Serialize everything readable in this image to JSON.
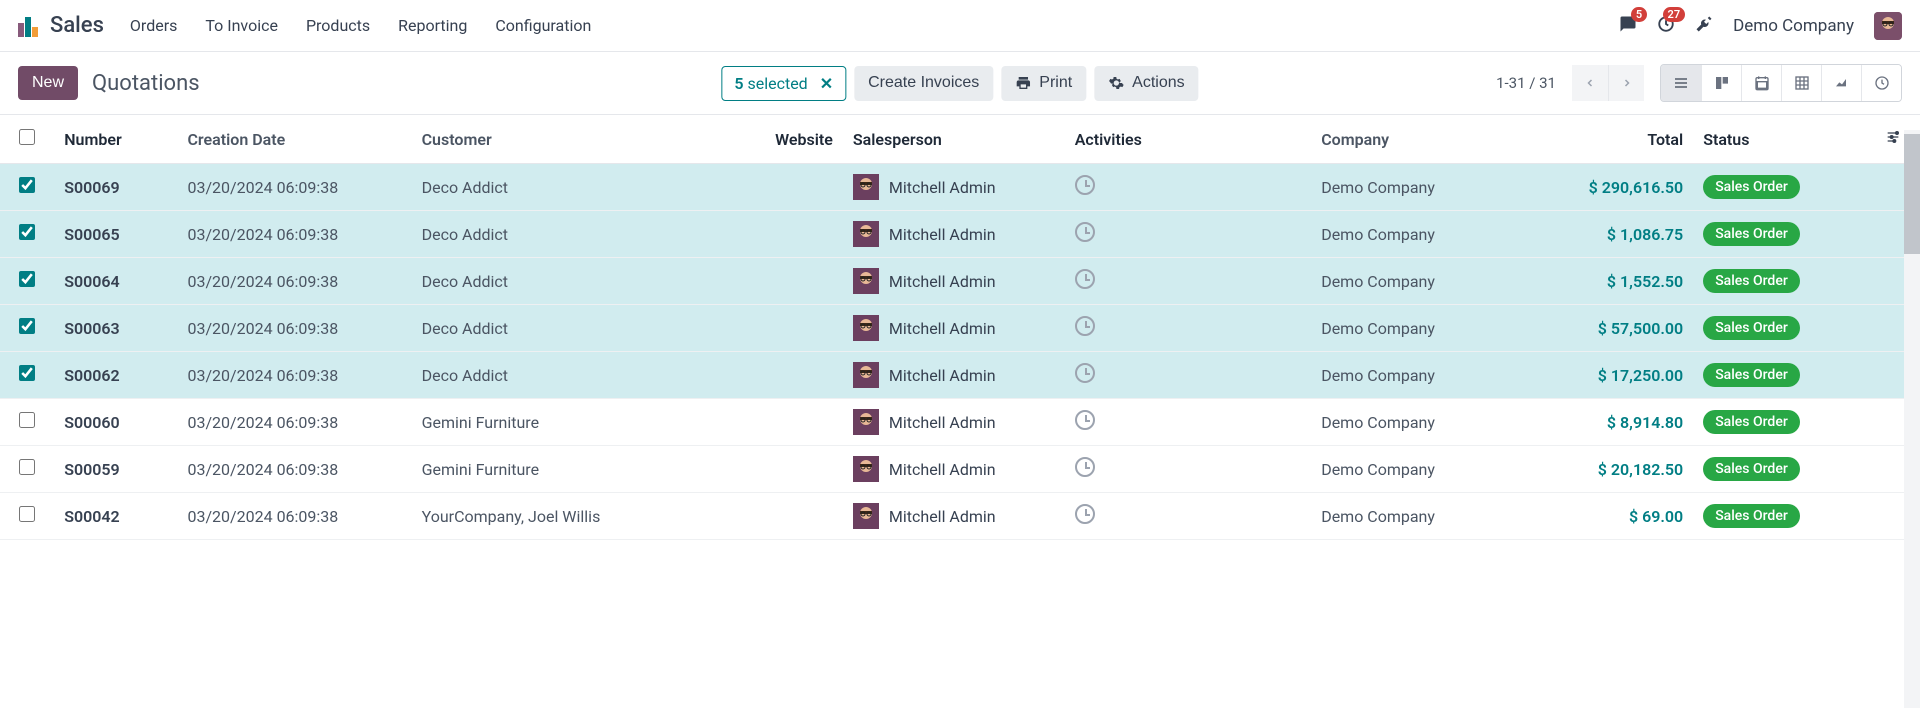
{
  "nav": {
    "app_title": "Sales",
    "items": [
      "Orders",
      "To Invoice",
      "Products",
      "Reporting",
      "Configuration"
    ],
    "messages_badge": "5",
    "activities_badge": "27",
    "company": "Demo Company"
  },
  "controls": {
    "new_label": "New",
    "page_title": "Quotations",
    "selected_count": "5",
    "selected_label": "selected",
    "create_invoices": "Create Invoices",
    "print": "Print",
    "actions": "Actions",
    "pager": "1-31 / 31"
  },
  "table": {
    "headers": {
      "number": "Number",
      "creation_date": "Creation Date",
      "customer": "Customer",
      "website": "Website",
      "salesperson": "Salesperson",
      "activities": "Activities",
      "company": "Company",
      "total": "Total",
      "status": "Status"
    },
    "rows": [
      {
        "selected": true,
        "number": "S00069",
        "date": "03/20/2024 06:09:38",
        "customer": "Deco Addict",
        "salesperson": "Mitchell Admin",
        "company": "Demo Company",
        "total": "$ 290,616.50",
        "status": "Sales Order"
      },
      {
        "selected": true,
        "number": "S00065",
        "date": "03/20/2024 06:09:38",
        "customer": "Deco Addict",
        "salesperson": "Mitchell Admin",
        "company": "Demo Company",
        "total": "$ 1,086.75",
        "status": "Sales Order"
      },
      {
        "selected": true,
        "number": "S00064",
        "date": "03/20/2024 06:09:38",
        "customer": "Deco Addict",
        "salesperson": "Mitchell Admin",
        "company": "Demo Company",
        "total": "$ 1,552.50",
        "status": "Sales Order"
      },
      {
        "selected": true,
        "number": "S00063",
        "date": "03/20/2024 06:09:38",
        "customer": "Deco Addict",
        "salesperson": "Mitchell Admin",
        "company": "Demo Company",
        "total": "$ 57,500.00",
        "status": "Sales Order"
      },
      {
        "selected": true,
        "number": "S00062",
        "date": "03/20/2024 06:09:38",
        "customer": "Deco Addict",
        "salesperson": "Mitchell Admin",
        "company": "Demo Company",
        "total": "$ 17,250.00",
        "status": "Sales Order"
      },
      {
        "selected": false,
        "number": "S00060",
        "date": "03/20/2024 06:09:38",
        "customer": "Gemini Furniture",
        "salesperson": "Mitchell Admin",
        "company": "Demo Company",
        "total": "$ 8,914.80",
        "status": "Sales Order"
      },
      {
        "selected": false,
        "number": "S00059",
        "date": "03/20/2024 06:09:38",
        "customer": "Gemini Furniture",
        "salesperson": "Mitchell Admin",
        "company": "Demo Company",
        "total": "$ 20,182.50",
        "status": "Sales Order"
      },
      {
        "selected": false,
        "number": "S00042",
        "date": "03/20/2024 06:09:38",
        "customer": "YourCompany, Joel Willis",
        "salesperson": "Mitchell Admin",
        "company": "Demo Company",
        "total": "$ 69.00",
        "status": "Sales Order"
      }
    ]
  }
}
